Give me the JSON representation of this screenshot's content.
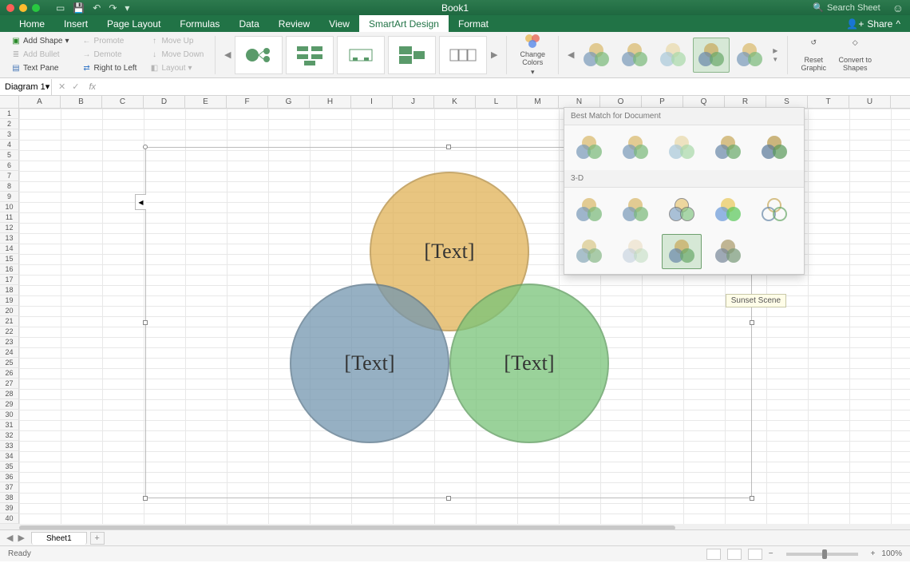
{
  "window": {
    "title": "Book1"
  },
  "search": {
    "placeholder": "Search Sheet"
  },
  "tabs": {
    "items": [
      "Home",
      "Insert",
      "Page Layout",
      "Formulas",
      "Data",
      "Review",
      "View",
      "SmartArt Design",
      "Format"
    ],
    "active": "SmartArt Design",
    "share": "Share"
  },
  "ribbon": {
    "addShape": "Add Shape",
    "addBullet": "Add Bullet",
    "textPane": "Text Pane",
    "promote": "Promote",
    "demote": "Demote",
    "rightToLeft": "Right to Left",
    "moveUp": "Move Up",
    "moveDown": "Move Down",
    "layout": "Layout",
    "changeColors": "Change Colors",
    "resetGraphic": "Reset Graphic",
    "convertToShapes": "Convert to Shapes"
  },
  "formula": {
    "name": "Diagram 1"
  },
  "columns": [
    "A",
    "B",
    "C",
    "D",
    "E",
    "F",
    "G",
    "H",
    "I",
    "J",
    "K",
    "L",
    "M",
    "N",
    "O",
    "P",
    "Q",
    "R",
    "S",
    "T",
    "U"
  ],
  "venn": {
    "top": "[Text]",
    "left": "[Text]",
    "right": "[Text]"
  },
  "dropdown": {
    "bestMatch": "Best Match for Document",
    "threeD": "3-D",
    "tooltip": "Sunset Scene"
  },
  "sheet": {
    "name": "Sheet1"
  },
  "status": {
    "ready": "Ready",
    "zoom": "100%"
  }
}
